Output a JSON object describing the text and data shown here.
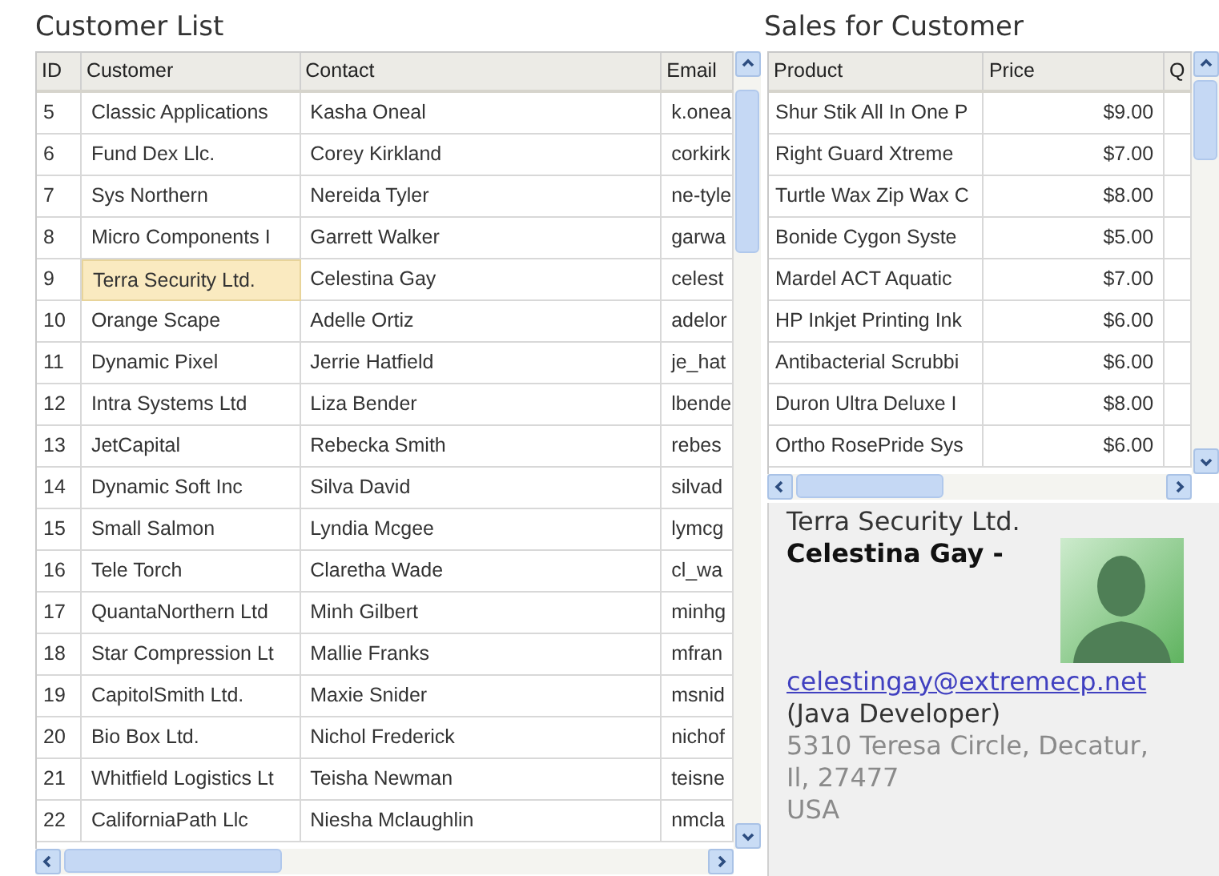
{
  "customer_list": {
    "title": "Customer List",
    "columns": [
      "ID",
      "Customer",
      "Contact",
      "Email"
    ],
    "rows": [
      {
        "id": "5",
        "customer": "Classic Applications",
        "contact": "Kasha Oneal",
        "email": "k.onea",
        "selected": false
      },
      {
        "id": "6",
        "customer": "Fund Dex Llc.",
        "contact": "Corey Kirkland",
        "email": "corkirk",
        "selected": false
      },
      {
        "id": "7",
        "customer": "Sys Northern",
        "contact": "Nereida Tyler",
        "email": "ne-tyle",
        "selected": false
      },
      {
        "id": "8",
        "customer": "Micro Components I",
        "contact": "Garrett Walker",
        "email": "garwa",
        "selected": false
      },
      {
        "id": "9",
        "customer": "Terra Security Ltd.",
        "contact": "Celestina Gay",
        "email": "celest",
        "selected": true
      },
      {
        "id": "10",
        "customer": "Orange Scape",
        "contact": "Adelle Ortiz",
        "email": "adelor",
        "selected": false
      },
      {
        "id": "11",
        "customer": "Dynamic Pixel",
        "contact": "Jerrie Hatfield",
        "email": "je_hat",
        "selected": false
      },
      {
        "id": "12",
        "customer": "Intra Systems Ltd",
        "contact": "Liza Bender",
        "email": "lbende",
        "selected": false
      },
      {
        "id": "13",
        "customer": "JetCapital",
        "contact": "Rebecka Smith",
        "email": "rebes",
        "selected": false
      },
      {
        "id": "14",
        "customer": "Dynamic Soft Inc",
        "contact": "Silva David",
        "email": "silvad",
        "selected": false
      },
      {
        "id": "15",
        "customer": "Small Salmon",
        "contact": "Lyndia Mcgee",
        "email": "lymcg",
        "selected": false
      },
      {
        "id": "16",
        "customer": "Tele Torch",
        "contact": "Claretha Wade",
        "email": "cl_wa",
        "selected": false
      },
      {
        "id": "17",
        "customer": "QuantaNorthern Ltd",
        "contact": "Minh Gilbert",
        "email": "minhg",
        "selected": false
      },
      {
        "id": "18",
        "customer": "Star Compression Lt",
        "contact": "Mallie Franks",
        "email": "mfran",
        "selected": false
      },
      {
        "id": "19",
        "customer": "CapitolSmith Ltd.",
        "contact": "Maxie Snider",
        "email": "msnid",
        "selected": false
      },
      {
        "id": "20",
        "customer": "Bio Box Ltd.",
        "contact": "Nichol Frederick",
        "email": "nichof",
        "selected": false
      },
      {
        "id": "21",
        "customer": "Whitfield Logistics Lt",
        "contact": "Teisha Newman",
        "email": "teisne",
        "selected": false
      },
      {
        "id": "22",
        "customer": "CaliforniaPath Llc",
        "contact": "Niesha Mclaughlin",
        "email": "nmcla",
        "selected": false
      }
    ]
  },
  "sales": {
    "title": "Sales for Customer",
    "columns": [
      "Product",
      "Price",
      "Q"
    ],
    "rows": [
      {
        "product": "Shur Stik All In One P",
        "price": "$9.00"
      },
      {
        "product": "Right Guard Xtreme",
        "price": "$7.00"
      },
      {
        "product": "Turtle Wax Zip Wax C",
        "price": "$8.00"
      },
      {
        "product": "Bonide Cygon Syste",
        "price": "$5.00"
      },
      {
        "product": "Mardel ACT Aquatic",
        "price": "$7.00"
      },
      {
        "product": "HP Inkjet Printing Ink",
        "price": "$6.00"
      },
      {
        "product": "Antibacterial Scrubbi",
        "price": "$6.00"
      },
      {
        "product": "Duron Ultra Deluxe I",
        "price": "$8.00"
      },
      {
        "product": "Ortho RosePride Sys",
        "price": "$6.00"
      }
    ]
  },
  "details": {
    "company": "Terra Security Ltd.",
    "contact": "Celestina Gay -",
    "email": "celestingay@extremecp.net",
    "job": "(Java Developer)",
    "address": [
      "5310 Teresa Circle, Decatur,",
      "Il, 27477",
      "USA"
    ]
  }
}
